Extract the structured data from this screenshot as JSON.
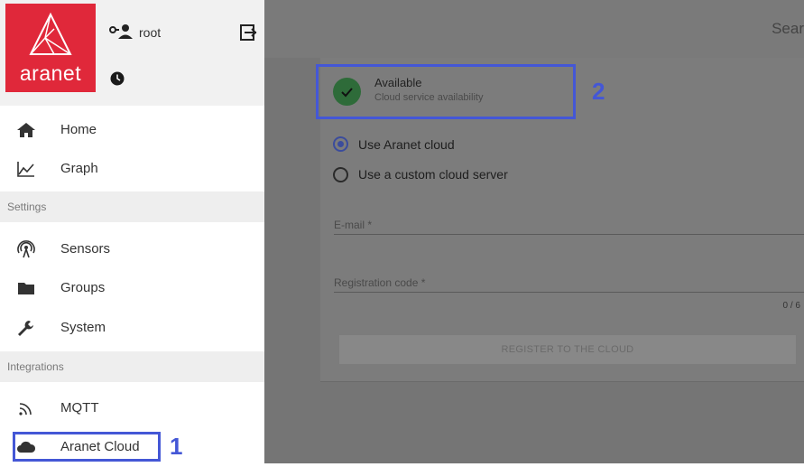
{
  "header": {
    "logo_text": "aranet",
    "user_name": "root"
  },
  "sidebar": {
    "items": [
      {
        "label": "Home",
        "icon": "home-icon"
      },
      {
        "label": "Graph",
        "icon": "graph-icon"
      },
      {
        "section": "Settings"
      },
      {
        "label": "Sensors",
        "icon": "sensor-icon"
      },
      {
        "label": "Groups",
        "icon": "folder-icon"
      },
      {
        "label": "System",
        "icon": "wrench-icon"
      },
      {
        "section": "Integrations"
      },
      {
        "label": "MQTT",
        "icon": "rss-icon"
      },
      {
        "label": "Aranet Cloud",
        "icon": "cloud-icon",
        "active": true
      }
    ]
  },
  "annotations": {
    "one": "1",
    "two": "2"
  },
  "topbar": {
    "search": "Sear"
  },
  "cloud": {
    "status_title": "Available",
    "status_subtitle": "Cloud service availability",
    "option_aranet": "Use Aranet cloud",
    "option_custom": "Use a custom cloud server",
    "email_label": "E-mail *",
    "code_label": "Registration code *",
    "code_counter": "0 / 6",
    "register_label": "REGISTER TO THE CLOUD"
  },
  "colors": {
    "brand": "#e0283a",
    "annotation": "#4457d6",
    "success": "#2e6b39"
  }
}
